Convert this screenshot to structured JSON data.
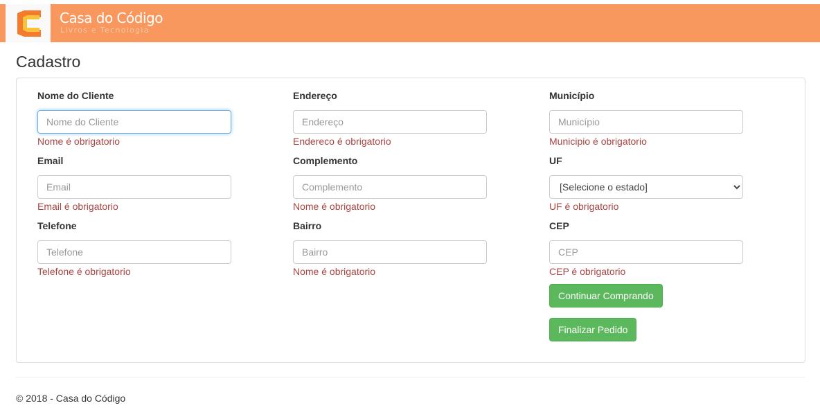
{
  "header": {
    "brand": "Casa do Código",
    "tagline": "Livros e Tecnologia",
    "logo_icon": "casa-do-codigo-logo-icon",
    "colors": {
      "navbar": "#f8975e",
      "logo_orange": "#f47a2c",
      "logo_yellow": "#f9c23c"
    }
  },
  "page": {
    "title": "Cadastro"
  },
  "form": {
    "fields": {
      "nome": {
        "label": "Nome do Cliente",
        "placeholder": "Nome do Cliente",
        "value": "",
        "error": "Nome é obrigatorio"
      },
      "email": {
        "label": "Email",
        "placeholder": "Email",
        "value": "",
        "error": "Email é obrigatorio"
      },
      "telefone": {
        "label": "Telefone",
        "placeholder": "Telefone",
        "value": "",
        "error": "Telefone é obrigatorio"
      },
      "endereco": {
        "label": "Endereço",
        "placeholder": "Endereço",
        "value": "",
        "error": "Endereco é obrigatorio"
      },
      "complemento": {
        "label": "Complemento",
        "placeholder": "Complemento",
        "value": "",
        "error": "Nome é obrigatorio"
      },
      "bairro": {
        "label": "Bairro",
        "placeholder": "Bairro",
        "value": "",
        "error": "Nome é obrigatorio"
      },
      "municipio": {
        "label": "Município",
        "placeholder": "Município",
        "value": "",
        "error": "Municipio é obrigatorio"
      },
      "uf": {
        "label": "UF",
        "selected": "[Selecione o estado]",
        "error": "UF é obrigatorio"
      },
      "cep": {
        "label": "CEP",
        "placeholder": "CEP",
        "value": "",
        "error": "CEP é obrigatorio"
      }
    },
    "buttons": {
      "continuar": "Continuar Comprando",
      "finalizar": "Finalizar Pedido"
    },
    "colors": {
      "error": "#a94442",
      "button": "#5cb85c",
      "focus": "#66afe9"
    }
  },
  "footer": {
    "text": "© 2018 - Casa do Código"
  }
}
